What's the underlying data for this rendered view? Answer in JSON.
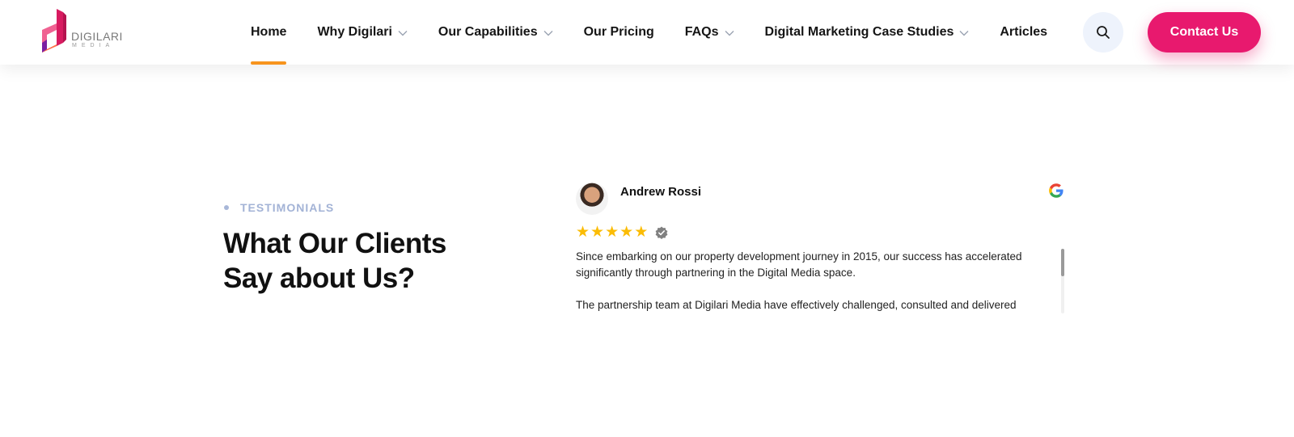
{
  "brand": {
    "logo_text": "DIGILARI",
    "logo_subtext": "MEDIA",
    "colors": {
      "accent": "#e8196e",
      "active_underline": "#f7941d",
      "eyebrow": "#a3b3d6"
    }
  },
  "nav": {
    "items": [
      {
        "label": "Home",
        "active": true,
        "dropdown": false
      },
      {
        "label": "Why Digilari",
        "active": false,
        "dropdown": true
      },
      {
        "label": "Our Capabilities",
        "active": false,
        "dropdown": true
      },
      {
        "label": "Our Pricing",
        "active": false,
        "dropdown": false
      },
      {
        "label": "FAQs",
        "active": false,
        "dropdown": true
      },
      {
        "label": "Digital Marketing Case Studies",
        "active": false,
        "dropdown": true
      },
      {
        "label": "Articles",
        "active": false,
        "dropdown": false
      }
    ],
    "search_icon": "search-icon",
    "contact_label": "Contact Us"
  },
  "testimonials": {
    "eyebrow": "TESTIMONIALS",
    "title_line1": "What Our Clients",
    "title_line2": "Say about Us?",
    "review": {
      "name": "Andrew Rossi",
      "rating": 5,
      "source_icon": "google-icon",
      "paragraph1": "Since embarking on our property development journey in 2015, our success has accelerated significantly through partnering in the Digital Media space.",
      "paragraph2": "The partnership team at Digilari Media have effectively challenged, consulted and delivered"
    }
  }
}
